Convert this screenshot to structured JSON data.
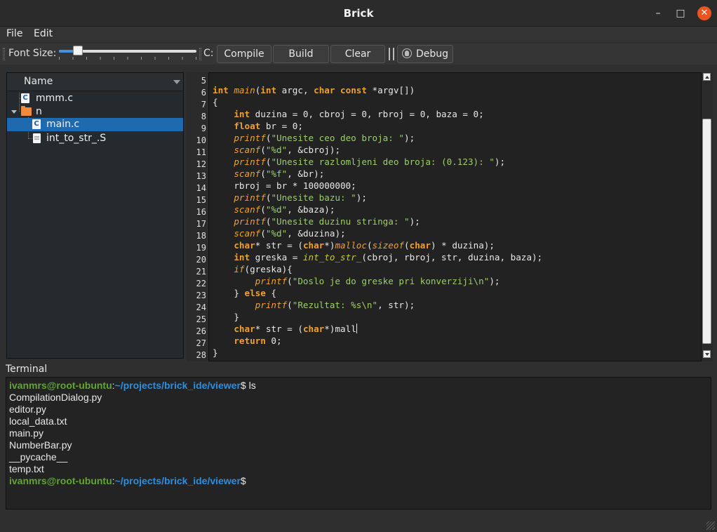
{
  "window": {
    "title": "Brick",
    "minimize_glyph": "–",
    "maximize_glyph": "□",
    "close_glyph": "✕"
  },
  "menu": [
    {
      "label": "File"
    },
    {
      "label": "Edit"
    }
  ],
  "toolbar": {
    "font_size_label": "Font Size:",
    "font_size_slider_fraction": 0.14,
    "c_label": "C:",
    "compile_label": "Compile",
    "build_label": "Build",
    "clear_label": "Clear",
    "debug_label": "Debug",
    "debug_icon": "bug-icon"
  },
  "file_tree": {
    "header": "Name",
    "items": [
      {
        "label": "mmm.c",
        "icon": "c-file-icon"
      },
      {
        "label": "n",
        "icon": "folder-icon",
        "expanded": true
      },
      {
        "label": "main.c",
        "icon": "c-file-icon",
        "selected": true
      },
      {
        "label": "int_to_str_.S",
        "icon": "text-file-icon"
      }
    ]
  },
  "editor": {
    "line_numbers": [
      "5",
      "6",
      "7",
      "8",
      "9",
      "10",
      "11",
      "12",
      "13",
      "14",
      "15",
      "16",
      "17",
      "18",
      "19",
      "20",
      "21",
      "22",
      "23",
      "24",
      "25",
      "26",
      "27",
      "28"
    ],
    "scrollbar_fraction": {
      "start": 0.16,
      "end": 0.94
    }
  },
  "terminal": {
    "label": "Terminal",
    "user": "ivanmrs@root-ubuntu",
    "path": "~/projects/brick_ide/viewer",
    "command": "$ ls",
    "prompt_end": "$",
    "output": [
      "CompilationDialog.py",
      "editor.py",
      "local_data.txt",
      "main.py",
      "NumberBar.py",
      "__pycache__",
      "temp.txt"
    ]
  },
  "colors": {
    "keyword": "#f0a030",
    "string": "#99d066",
    "selection": "#1f6aae",
    "terminal_user": "#62a438",
    "terminal_path": "#2d8de0",
    "close_button": "#e95420"
  }
}
